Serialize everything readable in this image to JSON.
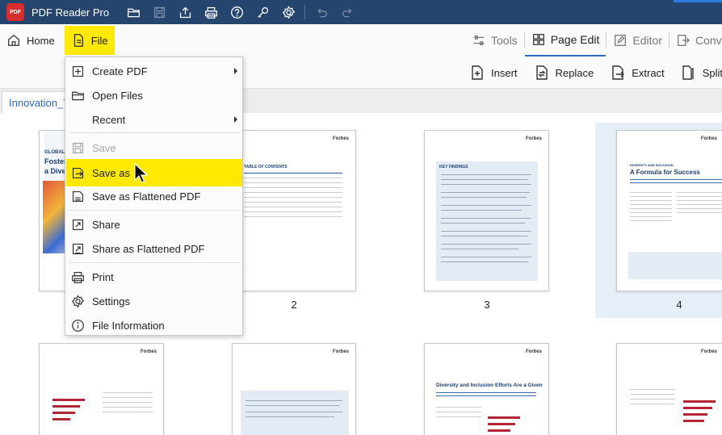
{
  "app": {
    "title": "PDF Reader Pro",
    "logo_text": "PDF"
  },
  "quick_access": [
    {
      "icon": "open-folder-icon"
    },
    {
      "icon": "save-disk-icon"
    },
    {
      "icon": "share-icon"
    },
    {
      "icon": "print-icon"
    },
    {
      "icon": "help-icon"
    },
    {
      "icon": "key-icon"
    },
    {
      "icon": "settings-gear-icon"
    },
    {
      "icon": "undo-icon"
    },
    {
      "icon": "redo-icon"
    }
  ],
  "menubar": {
    "home": "Home",
    "file": "File",
    "right_tabs": [
      "Tools",
      "Page Edit",
      "Editor",
      "Convert"
    ],
    "active_tab": "Page Edit"
  },
  "page_edit_tools": [
    "Insert",
    "Replace",
    "Extract",
    "Split"
  ],
  "document_tab": "Innovation_Tr",
  "file_menu": {
    "items": [
      {
        "label": "Create PDF",
        "icon": "create-pdf-icon",
        "submenu": true,
        "disabled": false
      },
      {
        "label": "Open Files",
        "icon": "open-folder-icon",
        "submenu": false,
        "disabled": false
      },
      {
        "label": "Recent",
        "icon": "",
        "submenu": true,
        "disabled": false
      },
      {
        "label": "Save",
        "icon": "save-disk-icon",
        "submenu": false,
        "disabled": true
      },
      {
        "label": "Save as",
        "icon": "save-as-icon",
        "submenu": false,
        "disabled": false,
        "highlighted": true
      },
      {
        "label": "Save as Flattened PDF",
        "icon": "save-flattened-icon",
        "submenu": false,
        "disabled": false
      },
      {
        "label": "Share",
        "icon": "share-icon",
        "submenu": false,
        "disabled": false
      },
      {
        "label": "Share as Flattened PDF",
        "icon": "share-flattened-icon",
        "submenu": false,
        "disabled": false
      },
      {
        "label": "Print",
        "icon": "print-icon",
        "submenu": false,
        "disabled": false
      },
      {
        "label": "Settings",
        "icon": "settings-gear-icon",
        "submenu": false,
        "disabled": false
      },
      {
        "label": "File Information",
        "icon": "info-icon",
        "submenu": false,
        "disabled": false
      }
    ]
  },
  "pages": {
    "labels": [
      "2",
      "3",
      "4"
    ],
    "selected": "4",
    "brand": "Forbes",
    "thumb_texts": {
      "p1_line1": "GLOBAL",
      "p1_line2": "Foster",
      "p1_line3": "a Dive",
      "p2_heading": "TABLE OF CONTENTS",
      "p3_heading": "KEY FINDINGS",
      "p4_kicker": "DIVERSITY AND INCLUSION",
      "p4_heading": "A Formula for Success",
      "p7_heading": "Diversity and Inclusion Efforts Are a Given"
    }
  },
  "colors": {
    "titlebar": "#25456f",
    "highlight": "#ffe900",
    "accent": "#2a6bc7",
    "selected_page_bg": "#e6eef8"
  }
}
